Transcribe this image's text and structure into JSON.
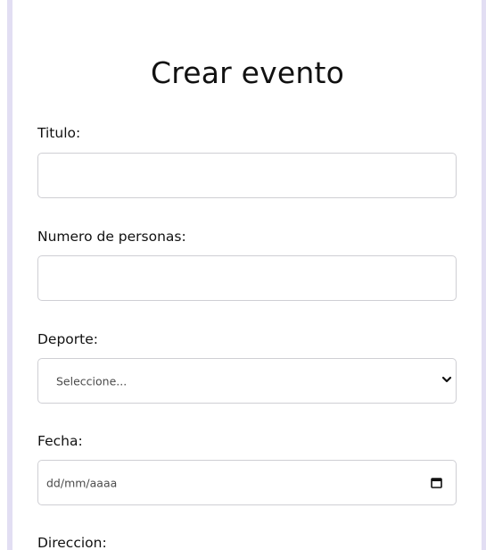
{
  "form": {
    "title": "Crear evento",
    "fields": [
      {
        "label": "Titulo:",
        "value": ""
      },
      {
        "label": "Numero de personas:",
        "value": ""
      },
      {
        "label": "Deporte:",
        "selected": "Seleccione..."
      },
      {
        "label": "Fecha:",
        "placeholder": "dd/mm/aaaa"
      },
      {
        "label": "Direccion:"
      }
    ]
  },
  "icons": {
    "select": "chevron-down-icon",
    "date": "calendar-icon"
  },
  "colors": {
    "side_border": "#e2def3",
    "field_border": "#cfcfd4",
    "text": "#111111"
  }
}
